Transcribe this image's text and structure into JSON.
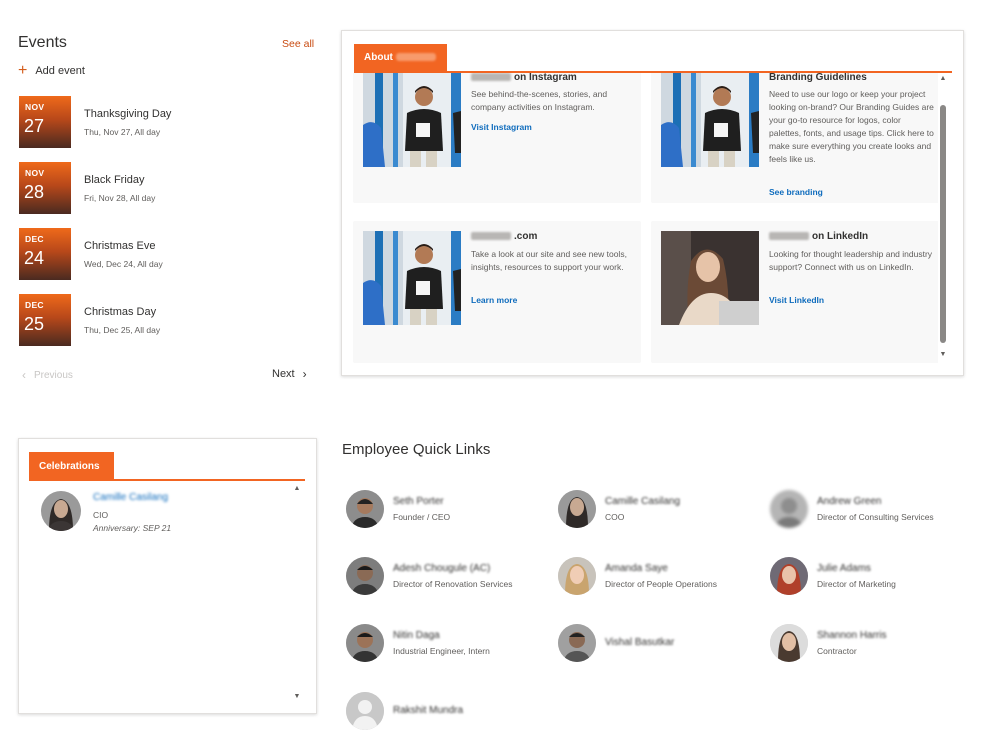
{
  "events": {
    "title": "Events",
    "see_all": "See all",
    "add_event": "Add event",
    "items": [
      {
        "month": "NOV",
        "day": "27",
        "title": "Thanksgiving Day",
        "sub": "Thu, Nov 27, All day"
      },
      {
        "month": "NOV",
        "day": "28",
        "title": "Black Friday",
        "sub": "Fri, Nov 28, All day"
      },
      {
        "month": "DEC",
        "day": "24",
        "title": "Christmas Eve",
        "sub": "Wed, Dec 24, All day"
      },
      {
        "month": "DEC",
        "day": "25",
        "title": "Christmas Day",
        "sub": "Thu, Dec 25, All day"
      }
    ],
    "previous": "Previous",
    "next": "Next"
  },
  "about": {
    "tab_label": "About",
    "cards": [
      {
        "title_suffix": "on Instagram",
        "desc": "See behind-the-scenes, stories, and company activities on Instagram.",
        "link": "Visit Instagram",
        "image": "person-holding-cup-photo"
      },
      {
        "title_suffix": "Branding Guidelines",
        "desc": "Need to use our logo or keep your project looking on-brand? Our Branding Guides are your go-to resource for logos, color palettes, fonts, and usage tips. Click here to make sure everything you create looks and feels like us.",
        "link": "See branding",
        "image": "person-holding-cup-photo"
      },
      {
        "title_suffix": ".com",
        "desc": "Take a look at our site and see new tools, insights, resources to support your work.",
        "link": "Learn more",
        "image": "person-holding-cup-photo"
      },
      {
        "title_suffix": "on LinkedIn",
        "desc": "Looking for thought leadership and industry support? Connect with us on LinkedIn.",
        "link": "Visit LinkedIn",
        "image": "woman-with-laptop-photo"
      }
    ]
  },
  "celebrations": {
    "tab_label": "Celebrations",
    "person": {
      "name": "Camille Casilang",
      "role": "CIO",
      "anniversary": "Anniversary: SEP 21"
    }
  },
  "quick_links": {
    "title": "Employee Quick Links",
    "people": [
      {
        "name": "Seth Porter",
        "role": "Founder / CEO"
      },
      {
        "name": "Camille Casilang",
        "role": "COO"
      },
      {
        "name": "Andrew Green",
        "role": "Director of Consulting Services"
      },
      {
        "name": "Adesh Chougule (AC)",
        "role": "Director of Renovation Services"
      },
      {
        "name": "Amanda Saye",
        "role": "Director of People Operations"
      },
      {
        "name": "Julie Adams",
        "role": "Director of Marketing"
      },
      {
        "name": "Nitin Daga",
        "role": "Industrial Engineer, Intern"
      },
      {
        "name": "Vishal Basutkar",
        "role": ""
      },
      {
        "name": "Shannon Harris",
        "role": "Contractor"
      },
      {
        "name": "Rakshit Mundra",
        "role": ""
      }
    ]
  }
}
